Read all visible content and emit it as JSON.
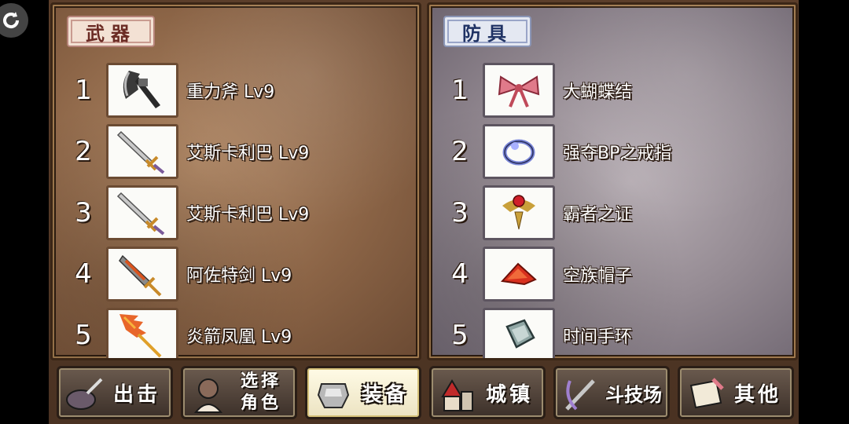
{
  "panels": {
    "weapons": {
      "title": "武器",
      "items": [
        {
          "num": "1",
          "name": "重力斧 Lv9",
          "icon": "heavy-axe-icon"
        },
        {
          "num": "2",
          "name": "艾斯卡利巴 Lv9",
          "icon": "silver-sword-icon"
        },
        {
          "num": "3",
          "name": "艾斯卡利巴 Lv9",
          "icon": "silver-sword-icon"
        },
        {
          "num": "4",
          "name": "阿佐特剑 Lv9",
          "icon": "flame-dagger-icon"
        },
        {
          "num": "5",
          "name": "炎箭凤凰 Lv9",
          "icon": "phoenix-spear-icon"
        }
      ]
    },
    "armor": {
      "title": "防具",
      "items": [
        {
          "num": "1",
          "name": "大蝴蝶结",
          "icon": "pink-bow-icon"
        },
        {
          "num": "2",
          "name": "强夺BP之戒指",
          "icon": "ring-icon"
        },
        {
          "num": "3",
          "name": "霸者之证",
          "icon": "medal-icon"
        },
        {
          "num": "4",
          "name": "空族帽子",
          "icon": "red-hat-icon"
        },
        {
          "num": "5",
          "name": "时间手环",
          "icon": "bracelet-icon"
        }
      ]
    }
  },
  "menu": [
    {
      "label": "出击",
      "icon": "sortie-icon",
      "active": false
    },
    {
      "label_line1": "选择",
      "label_line2": "角色",
      "icon": "character-select-icon",
      "active": false
    },
    {
      "label": "装备",
      "icon": "armor-equip-icon",
      "active": true
    },
    {
      "label": "城镇",
      "icon": "town-icon",
      "active": false
    },
    {
      "label": "斗技场",
      "icon": "arena-swords-icon",
      "active": false
    },
    {
      "label": "其他",
      "icon": "scroll-other-icon",
      "active": false
    }
  ],
  "colors": {
    "weapons_tag": "#6b2b24",
    "armor_tag": "#1f3264"
  }
}
